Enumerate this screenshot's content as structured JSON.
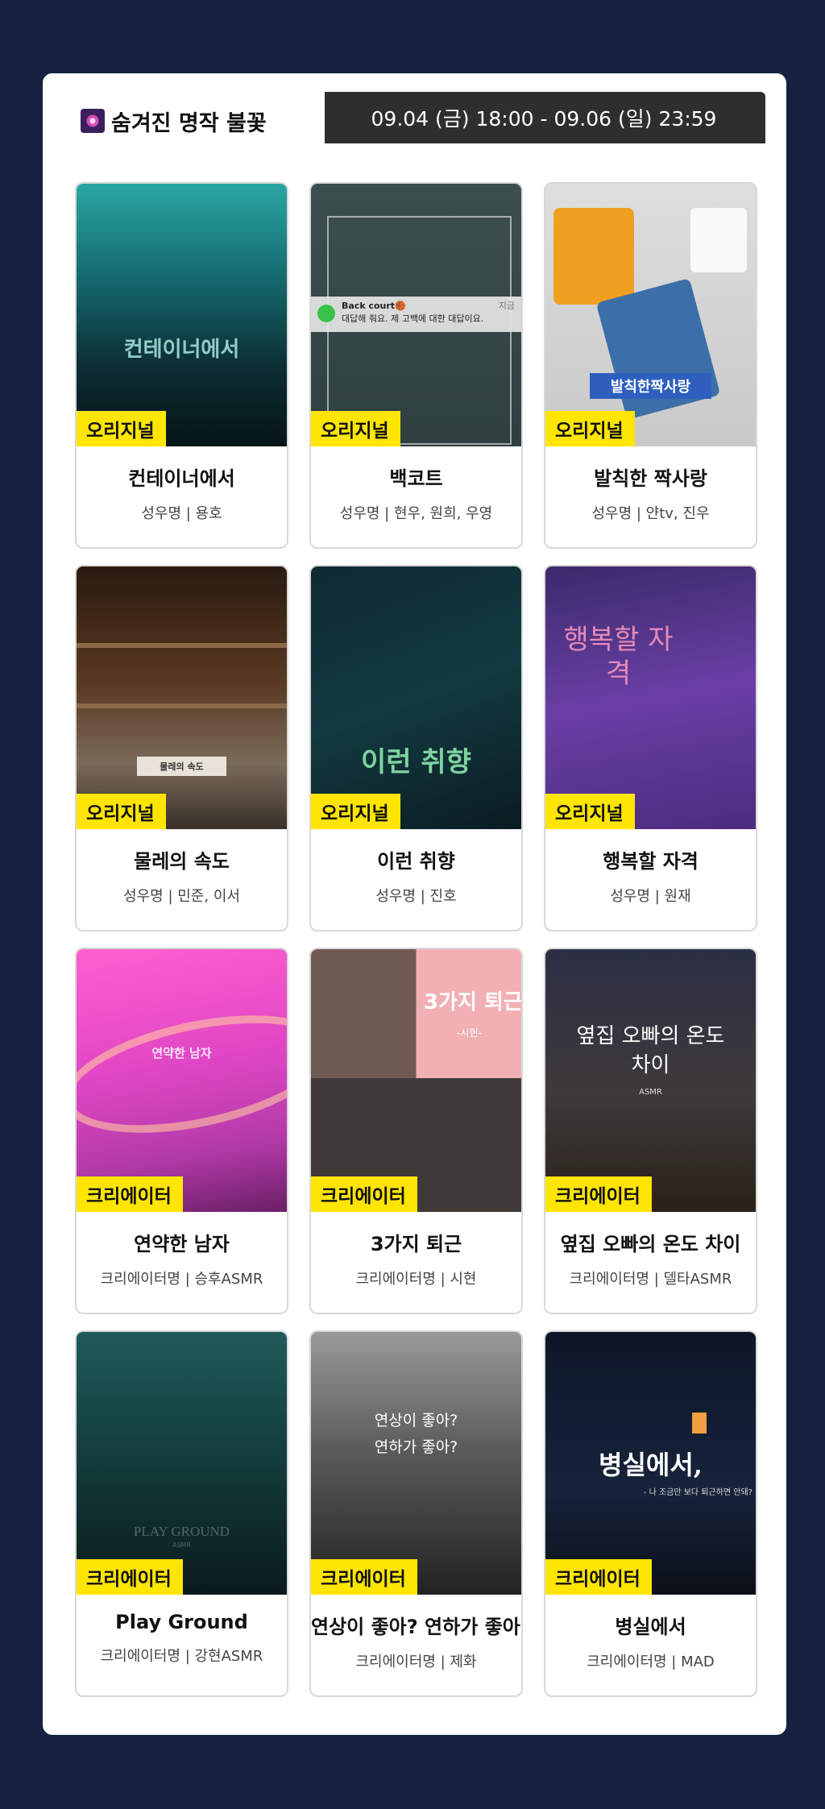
{
  "header": {
    "title": "숨겨진 명작 불꽃",
    "title_icon": "firework-icon",
    "period": "09.04 (금) 18:00 - 09.06 (일) 23:59"
  },
  "cards": [
    {
      "badge": "오리지널",
      "title": "컨테이너에서",
      "sub": "성우명 | 용호",
      "poster_text": "컨테이너에서"
    },
    {
      "badge": "오리지널",
      "title": "백코트",
      "sub": "성우명 | 현우, 원희, 우영",
      "poster_text": "",
      "notif_title": "Back court🏀",
      "notif_body": "대답해 줘요. 제 고백에 대한 대답이요.",
      "notif_time": "지금"
    },
    {
      "badge": "오리지널",
      "title": "발칙한 짝사랑",
      "sub": "성우명 | 얀tv, 진우",
      "poster_text": "발칙한짝사랑"
    },
    {
      "badge": "오리지널",
      "title": "물레의 속도",
      "sub": "성우명 | 민준, 이서",
      "poster_text": "물레의 속도"
    },
    {
      "badge": "오리지널",
      "title": "이런 취향",
      "sub": "성우명 | 진호",
      "poster_text": "이런 취향"
    },
    {
      "badge": "오리지널",
      "title": "행복할 자격",
      "sub": "성우명 | 원재",
      "poster_text": "행복할 자격"
    },
    {
      "badge": "크리에이터",
      "title": "연약한 남자",
      "sub": "크리에이터명 | 승후ASMR",
      "poster_text": "연약한 남자"
    },
    {
      "badge": "크리에이터",
      "title": "3가지 퇴근",
      "sub": "크리에이터명 | 시현",
      "poster_text": "3가지 퇴근",
      "poster_sub": "-시현-"
    },
    {
      "badge": "크리에이터",
      "title": "옆집 오빠의 온도 차이",
      "sub": "크리에이터명 | 델타ASMR",
      "poster_text": "옆집 오빠의 온도차이",
      "poster_sub": "ASMR"
    },
    {
      "badge": "크리에이터",
      "title": "Play Ground",
      "sub": "크리에이터명 | 강현ASMR",
      "poster_text": "PLAY GROUND",
      "poster_sub": "ASMR"
    },
    {
      "badge": "크리에이터",
      "title": "연상이 좋아? 연하가 좋아?",
      "sub": "크리에이터명 | 제화",
      "poster_text": "연상이 좋아?",
      "poster_sub": "연하가 좋아?"
    },
    {
      "badge": "크리에이터",
      "title": "병실에서",
      "sub": "크리에이터명 | MAD",
      "poster_text": "병실에서,",
      "poster_sub": "- 나 조금만 보다 퇴근하면 안돼?"
    }
  ],
  "colors": {
    "background": "#16213f",
    "badge": "#ffe500",
    "period_tab": "#2c2f2b"
  }
}
